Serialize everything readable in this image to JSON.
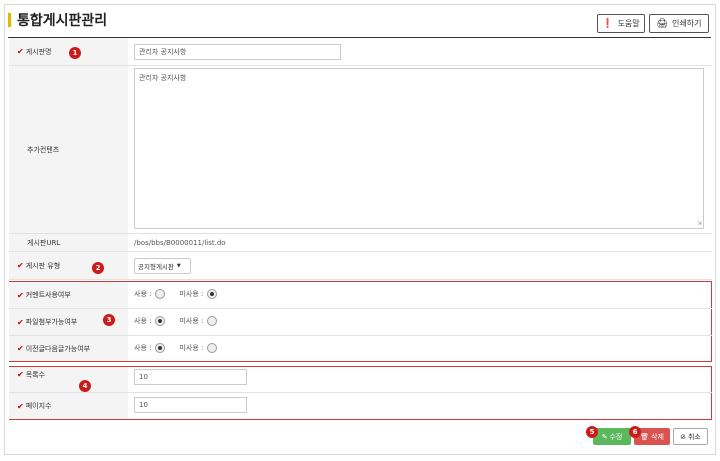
{
  "header": {
    "title": "통합게시판관리",
    "help_label": "도움말",
    "print_label": "인쇄하기"
  },
  "form": {
    "board_name": {
      "label": "게시판명",
      "value": "관리자 공지사항"
    },
    "extra_contents": {
      "label": "추가컨텐츠",
      "value": "관리자 공지사항"
    },
    "board_url": {
      "label": "게시판URL",
      "value": "/bos/bbs/B0000011/list.do"
    },
    "board_type": {
      "label": "게시판 유형",
      "value": "공지형게시판"
    },
    "comment_use": {
      "label": "커멘트사용여부",
      "use_label": "사용 :",
      "nouse_label": "미사용 :",
      "selected": "미사용"
    },
    "attach_allow": {
      "label": "파일첨부가능여부",
      "use_label": "사용 :",
      "nouse_label": "미사용 :",
      "selected": "사용"
    },
    "prev_next": {
      "label": "이전글다음글가능여부",
      "use_label": "사용 :",
      "nouse_label": "미사용 :",
      "selected": "사용"
    },
    "list_count": {
      "label": "목록수",
      "value": "10"
    },
    "page_count": {
      "label": "페이지수",
      "value": "10"
    }
  },
  "buttons": {
    "edit": "수정",
    "delete": "삭제",
    "cancel": "취소"
  },
  "badges": [
    "1",
    "2",
    "3",
    "4",
    "5",
    "6"
  ],
  "colors": {
    "accent": "#e5b800",
    "required": "#cc0000",
    "edit": "#4cae4c",
    "delete": "#d9534f"
  }
}
